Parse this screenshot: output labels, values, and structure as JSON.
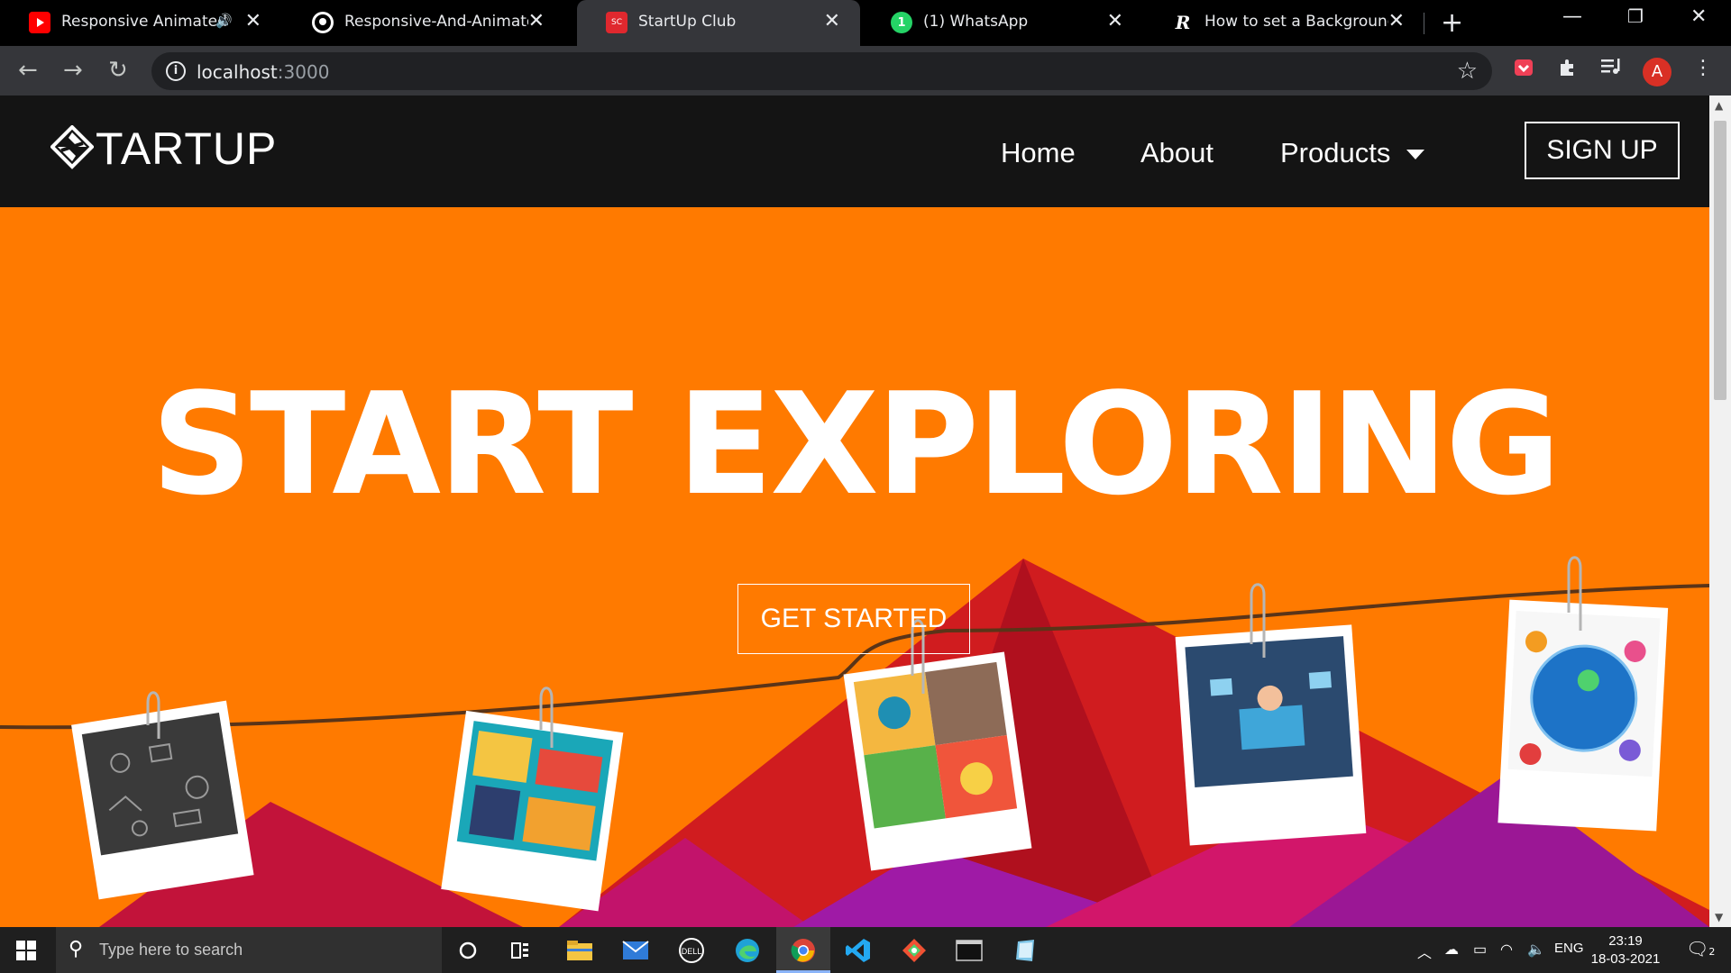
{
  "browser": {
    "tabs": [
      {
        "title": "Responsive Animated N",
        "favicon": "youtube-icon"
      },
      {
        "title": "Responsive-And-Animated-N",
        "favicon": "github-icon"
      },
      {
        "title": "StartUp Club",
        "favicon": "sc-icon",
        "favicon_text": "SC"
      },
      {
        "title": "(1) WhatsApp",
        "favicon": "whatsapp-icon",
        "favicon_text": "1"
      },
      {
        "title": "How to set a Background Im",
        "favicon": "r-icon",
        "favicon_text": "R"
      }
    ],
    "address": {
      "host": "localhost",
      "port": ":3000"
    },
    "profile_initial": "A"
  },
  "site": {
    "logo_text": "TARTUP",
    "nav": {
      "home": "Home",
      "about": "About",
      "products": "Products"
    },
    "signup": "SIGN UP",
    "hero_title": "START EXPLORING",
    "cta": "GET STARTED"
  },
  "taskbar": {
    "search_placeholder": "Type here to search",
    "lang": "ENG",
    "time": "23:19",
    "date": "18-03-2021",
    "notifications": "2"
  },
  "colors": {
    "hero_bg": "#ff7a00",
    "nav_bg": "#141414",
    "mountain_red": "#d01c1f",
    "mountain_crimson": "#b00a2a",
    "mountain_magenta": "#c2136b",
    "mountain_purple": "#8e1a93"
  }
}
